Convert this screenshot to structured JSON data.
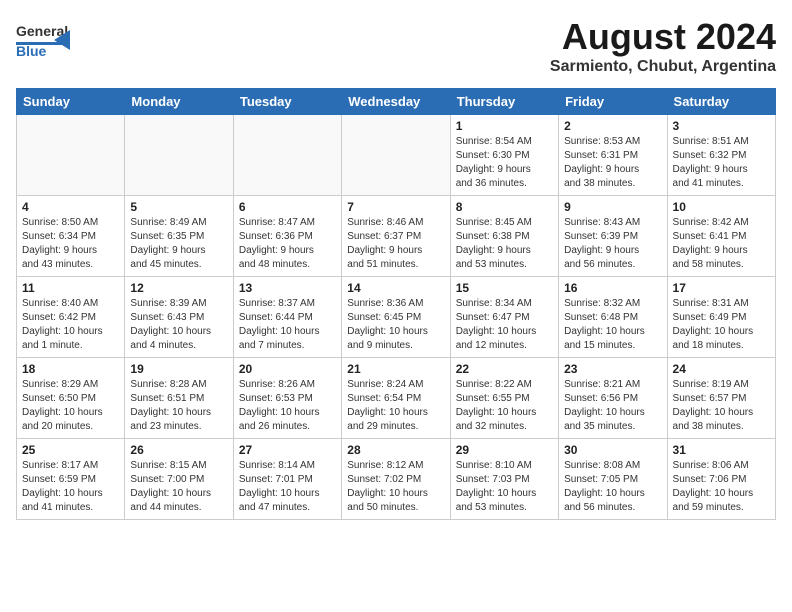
{
  "header": {
    "logo_general": "General",
    "logo_blue": "Blue",
    "month_year": "August 2024",
    "location": "Sarmiento, Chubut, Argentina"
  },
  "weekdays": [
    "Sunday",
    "Monday",
    "Tuesday",
    "Wednesday",
    "Thursday",
    "Friday",
    "Saturday"
  ],
  "weeks": [
    [
      {
        "day": "",
        "info": ""
      },
      {
        "day": "",
        "info": ""
      },
      {
        "day": "",
        "info": ""
      },
      {
        "day": "",
        "info": ""
      },
      {
        "day": "1",
        "info": "Sunrise: 8:54 AM\nSunset: 6:30 PM\nDaylight: 9 hours\nand 36 minutes."
      },
      {
        "day": "2",
        "info": "Sunrise: 8:53 AM\nSunset: 6:31 PM\nDaylight: 9 hours\nand 38 minutes."
      },
      {
        "day": "3",
        "info": "Sunrise: 8:51 AM\nSunset: 6:32 PM\nDaylight: 9 hours\nand 41 minutes."
      }
    ],
    [
      {
        "day": "4",
        "info": "Sunrise: 8:50 AM\nSunset: 6:34 PM\nDaylight: 9 hours\nand 43 minutes."
      },
      {
        "day": "5",
        "info": "Sunrise: 8:49 AM\nSunset: 6:35 PM\nDaylight: 9 hours\nand 45 minutes."
      },
      {
        "day": "6",
        "info": "Sunrise: 8:47 AM\nSunset: 6:36 PM\nDaylight: 9 hours\nand 48 minutes."
      },
      {
        "day": "7",
        "info": "Sunrise: 8:46 AM\nSunset: 6:37 PM\nDaylight: 9 hours\nand 51 minutes."
      },
      {
        "day": "8",
        "info": "Sunrise: 8:45 AM\nSunset: 6:38 PM\nDaylight: 9 hours\nand 53 minutes."
      },
      {
        "day": "9",
        "info": "Sunrise: 8:43 AM\nSunset: 6:39 PM\nDaylight: 9 hours\nand 56 minutes."
      },
      {
        "day": "10",
        "info": "Sunrise: 8:42 AM\nSunset: 6:41 PM\nDaylight: 9 hours\nand 58 minutes."
      }
    ],
    [
      {
        "day": "11",
        "info": "Sunrise: 8:40 AM\nSunset: 6:42 PM\nDaylight: 10 hours\nand 1 minute."
      },
      {
        "day": "12",
        "info": "Sunrise: 8:39 AM\nSunset: 6:43 PM\nDaylight: 10 hours\nand 4 minutes."
      },
      {
        "day": "13",
        "info": "Sunrise: 8:37 AM\nSunset: 6:44 PM\nDaylight: 10 hours\nand 7 minutes."
      },
      {
        "day": "14",
        "info": "Sunrise: 8:36 AM\nSunset: 6:45 PM\nDaylight: 10 hours\nand 9 minutes."
      },
      {
        "day": "15",
        "info": "Sunrise: 8:34 AM\nSunset: 6:47 PM\nDaylight: 10 hours\nand 12 minutes."
      },
      {
        "day": "16",
        "info": "Sunrise: 8:32 AM\nSunset: 6:48 PM\nDaylight: 10 hours\nand 15 minutes."
      },
      {
        "day": "17",
        "info": "Sunrise: 8:31 AM\nSunset: 6:49 PM\nDaylight: 10 hours\nand 18 minutes."
      }
    ],
    [
      {
        "day": "18",
        "info": "Sunrise: 8:29 AM\nSunset: 6:50 PM\nDaylight: 10 hours\nand 20 minutes."
      },
      {
        "day": "19",
        "info": "Sunrise: 8:28 AM\nSunset: 6:51 PM\nDaylight: 10 hours\nand 23 minutes."
      },
      {
        "day": "20",
        "info": "Sunrise: 8:26 AM\nSunset: 6:53 PM\nDaylight: 10 hours\nand 26 minutes."
      },
      {
        "day": "21",
        "info": "Sunrise: 8:24 AM\nSunset: 6:54 PM\nDaylight: 10 hours\nand 29 minutes."
      },
      {
        "day": "22",
        "info": "Sunrise: 8:22 AM\nSunset: 6:55 PM\nDaylight: 10 hours\nand 32 minutes."
      },
      {
        "day": "23",
        "info": "Sunrise: 8:21 AM\nSunset: 6:56 PM\nDaylight: 10 hours\nand 35 minutes."
      },
      {
        "day": "24",
        "info": "Sunrise: 8:19 AM\nSunset: 6:57 PM\nDaylight: 10 hours\nand 38 minutes."
      }
    ],
    [
      {
        "day": "25",
        "info": "Sunrise: 8:17 AM\nSunset: 6:59 PM\nDaylight: 10 hours\nand 41 minutes."
      },
      {
        "day": "26",
        "info": "Sunrise: 8:15 AM\nSunset: 7:00 PM\nDaylight: 10 hours\nand 44 minutes."
      },
      {
        "day": "27",
        "info": "Sunrise: 8:14 AM\nSunset: 7:01 PM\nDaylight: 10 hours\nand 47 minutes."
      },
      {
        "day": "28",
        "info": "Sunrise: 8:12 AM\nSunset: 7:02 PM\nDaylight: 10 hours\nand 50 minutes."
      },
      {
        "day": "29",
        "info": "Sunrise: 8:10 AM\nSunset: 7:03 PM\nDaylight: 10 hours\nand 53 minutes."
      },
      {
        "day": "30",
        "info": "Sunrise: 8:08 AM\nSunset: 7:05 PM\nDaylight: 10 hours\nand 56 minutes."
      },
      {
        "day": "31",
        "info": "Sunrise: 8:06 AM\nSunset: 7:06 PM\nDaylight: 10 hours\nand 59 minutes."
      }
    ]
  ]
}
